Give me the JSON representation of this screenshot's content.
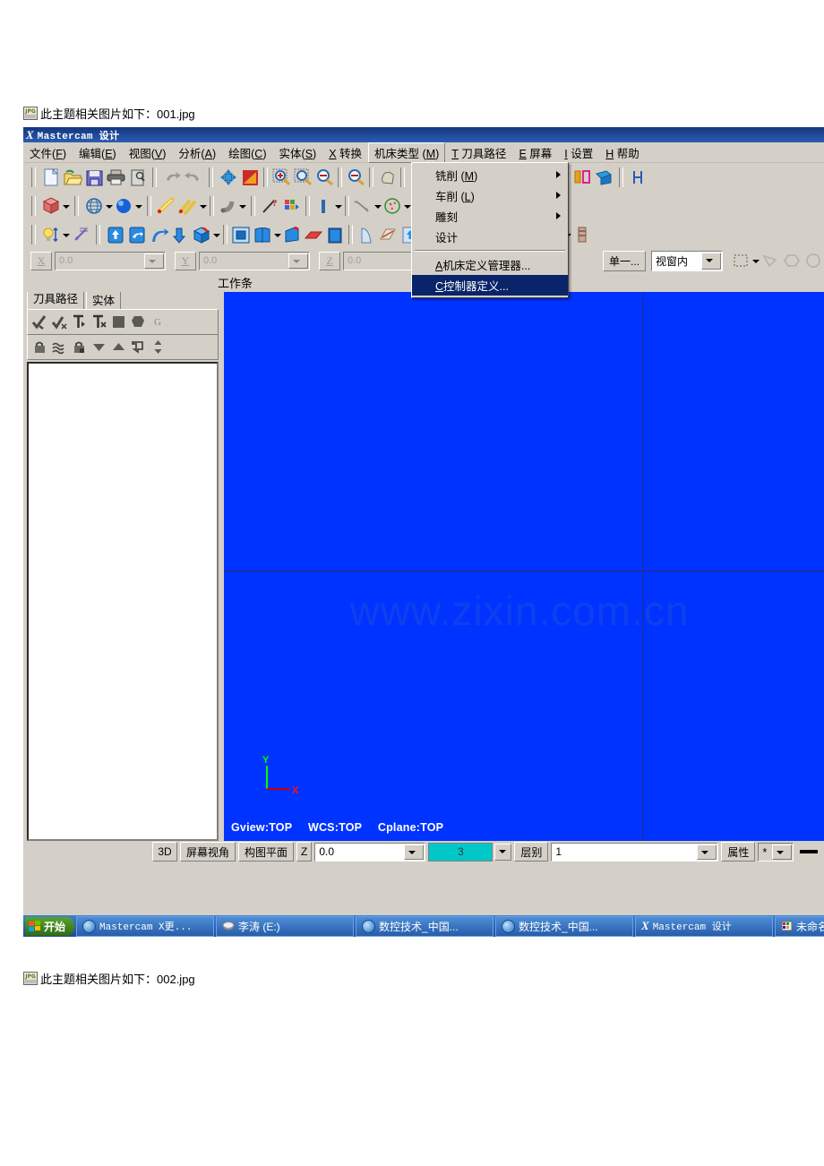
{
  "page": {
    "caption_top": "此主题相关图片如下：001.jpg",
    "caption_bottom": "此主题相关图片如下：002.jpg"
  },
  "window": {
    "title": "Mastercam 设计",
    "logo": "X"
  },
  "menubar": {
    "items": [
      {
        "label": "文件",
        "mnemonic": "F",
        "style": "zh-paren"
      },
      {
        "label": "编辑",
        "mnemonic": "E",
        "style": "zh-paren"
      },
      {
        "label": "视图",
        "mnemonic": "V",
        "style": "zh-paren"
      },
      {
        "label": "分析",
        "mnemonic": "A",
        "style": "zh-paren"
      },
      {
        "label": "绘图",
        "mnemonic": "C",
        "style": "zh-paren"
      },
      {
        "label": "实体",
        "mnemonic": "S",
        "style": "zh-paren"
      },
      {
        "label": "转换",
        "mnemonic": "X",
        "style": "pre"
      },
      {
        "label": "机床类型",
        "mnemonic": "M",
        "style": "zh-paren",
        "active": true
      },
      {
        "label": "刀具路径",
        "mnemonic": "T",
        "style": "pre"
      },
      {
        "label": "屏幕",
        "mnemonic": "E",
        "style": "pre"
      },
      {
        "label": "设置",
        "mnemonic": "I",
        "style": "pre"
      },
      {
        "label": "帮助",
        "mnemonic": "H",
        "style": "pre"
      }
    ]
  },
  "machine_menu": {
    "items": [
      {
        "label": "铣削",
        "mnemonic": "M",
        "submenu": true
      },
      {
        "label": "车削",
        "mnemonic": "L",
        "submenu": true
      },
      {
        "label": "雕刻",
        "mnemonic": "",
        "submenu": true
      },
      {
        "label": "设计",
        "mnemonic": "",
        "submenu": false
      },
      {
        "separator": true
      },
      {
        "label": "机床定义管理器...",
        "mnemonic": "A",
        "submenu": false
      },
      {
        "label": "控制器定义...",
        "mnemonic": "C",
        "submenu": false,
        "highlighted": true
      }
    ],
    "highlight_color": "#0a246a"
  },
  "toolbars": {
    "row1": [
      "new-file-icon",
      "open-folder-icon",
      "save-disk-icon",
      "print-icon",
      "print-preview-icon",
      "|",
      "undo-icon",
      "redo-icon",
      "|",
      "fit-screen-icon",
      "repaint-icon",
      "|",
      "zoom-window-icon",
      "zoom-target-icon",
      "zoom-out-icon",
      "|",
      "zoom-minus-icon",
      "|",
      "pan-icon",
      "|",
      "dynamic-rotate-icon",
      "|",
      "analyze-icon",
      "analyze-all-icon",
      "arrow",
      "|",
      "xform-translate-icon",
      "xform-mirror-icon",
      "xform-offset-icon",
      "xform-rotate-icon",
      "xform-scale-icon",
      "|",
      "dim-icon"
    ],
    "row2": [
      "wcs-cube-icon",
      "arrow",
      "|",
      "gview-globe-icon",
      "arrow",
      "shade-sphere-icon",
      "arrow",
      "|",
      "line-create-icon",
      "line-multi-icon",
      "arrow",
      "|",
      "fillet-icon",
      "arrow",
      "|",
      "point-icon",
      "color-grid-icon",
      "|",
      "level-icon",
      "arrow",
      "|",
      "arc-create-icon",
      "arrow",
      "curve-icon",
      "arrow",
      "|",
      "spline-icon",
      "arrow",
      "chamfer-icon",
      "arrow",
      "extrude-solid-icon",
      "arrow"
    ],
    "row3": [
      "light-icon",
      "arrow",
      "dimension-icon",
      "|",
      "extrude-up-icon",
      "revolve-icon",
      "sweep-icon",
      "loft-down-icon",
      "solid-bool-icon",
      "arrow",
      "|",
      "solid-shell-icon",
      "solid-trim-icon",
      "arrow",
      "solid-chamfer-icon",
      "solid-fillet-icon",
      "solid-draft-icon",
      "|",
      "surface-icon",
      "surface-trim-icon",
      "surface-flow-icon",
      "arrow",
      "|",
      "mesh-icon",
      "mesh2-icon",
      "mesh-cube-icon",
      "|",
      "render-icon",
      "arrow",
      "hatch-icon",
      "arrow",
      "material-icon"
    ]
  },
  "coordbar": {
    "x_label": "X",
    "x_value": "0.0",
    "y_label": "Y",
    "y_value": "0.0",
    "z_label": "Z",
    "z_value": "0.0",
    "select_button": "单一...",
    "view_mode": "视窗内"
  },
  "workspace_label": "工作条",
  "left_panel": {
    "tabs": [
      {
        "label": "刀具路径",
        "selected": true
      },
      {
        "label": "实体",
        "selected": false
      }
    ],
    "toolbar_row1": [
      "select-all-ops-icon",
      "deselect-all-ops-icon",
      "regen-path-icon",
      "regen-dirty-icon",
      "verify-solid-icon",
      "backplot-icon",
      "post-g1-icon"
    ],
    "toolbar_row2": [
      "lock-icon",
      "toolpath-display-icon",
      "lock-post-icon",
      "move-down-icon",
      "move-up-icon",
      "reorder-icon",
      "updown-icon"
    ]
  },
  "canvas": {
    "background_color": "#0033ff",
    "watermark": "www.zixin.com.cn",
    "axis": {
      "y_label": "Y",
      "x_label": "X",
      "y_color": "#00ff00",
      "x_color": "#ff0000"
    },
    "view_info": [
      "Gview:TOP",
      "WCS:TOP",
      "Cplane:TOP"
    ]
  },
  "statusbar": {
    "dim_mode": "3D",
    "gview_button": "屏幕视角",
    "cplane_button": "构图平面",
    "z_label": "Z",
    "z_value": "0.0",
    "color_number": "3",
    "level_label": "层别",
    "level_value": "1",
    "attributes_button": "属性",
    "point_style": "*"
  },
  "taskbar": {
    "start": "开始",
    "buttons": [
      {
        "label": "Mastercam X更...",
        "icon": "ie-icon",
        "mono": true
      },
      {
        "label": "李涛 (E:)",
        "icon": "drive-icon",
        "mono": false
      },
      {
        "label": "数控技术_中国...",
        "icon": "ie-icon",
        "mono": false
      },
      {
        "label": "数控技术_中国...",
        "icon": "ie-icon",
        "mono": false
      },
      {
        "label": "Mastercam 设计",
        "icon": "mastercam-icon",
        "mono": true
      },
      {
        "label": "未命名 -",
        "icon": "paint-icon",
        "mono": false
      }
    ]
  }
}
